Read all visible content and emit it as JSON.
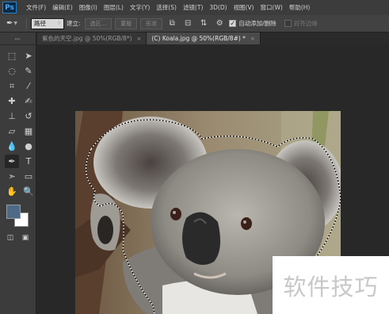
{
  "app": {
    "logo": "Ps"
  },
  "menu": [
    "文件(F)",
    "编辑(E)",
    "图像(I)",
    "图层(L)",
    "文字(Y)",
    "选择(S)",
    "滤镜(T)",
    "3D(D)",
    "视图(V)",
    "窗口(W)",
    "帮助(H)"
  ],
  "options": {
    "tool_icon": "pen-tool-icon",
    "mode_value": "路径",
    "make_label": "建立:",
    "selection_button": "选区...",
    "mask_button": "蒙版",
    "shape_button": "形状",
    "auto_add_delete_label": "自动添加/删除",
    "auto_add_delete_checked": true,
    "align_edges_label": "对齐边缘",
    "align_edges_checked": false
  },
  "tabs": [
    {
      "label": "紫色的天空.jpg @ 50%(RGB/8*)",
      "close": "×",
      "active": false
    },
    {
      "label": "(C) Koala.jpg @ 50%(RGB/8#) *",
      "close": "×",
      "active": true
    }
  ],
  "colors": {
    "foreground": "#4d6b88",
    "background": "#ffffff",
    "accent": "#3fa9f5"
  },
  "watermark": "软件技巧"
}
